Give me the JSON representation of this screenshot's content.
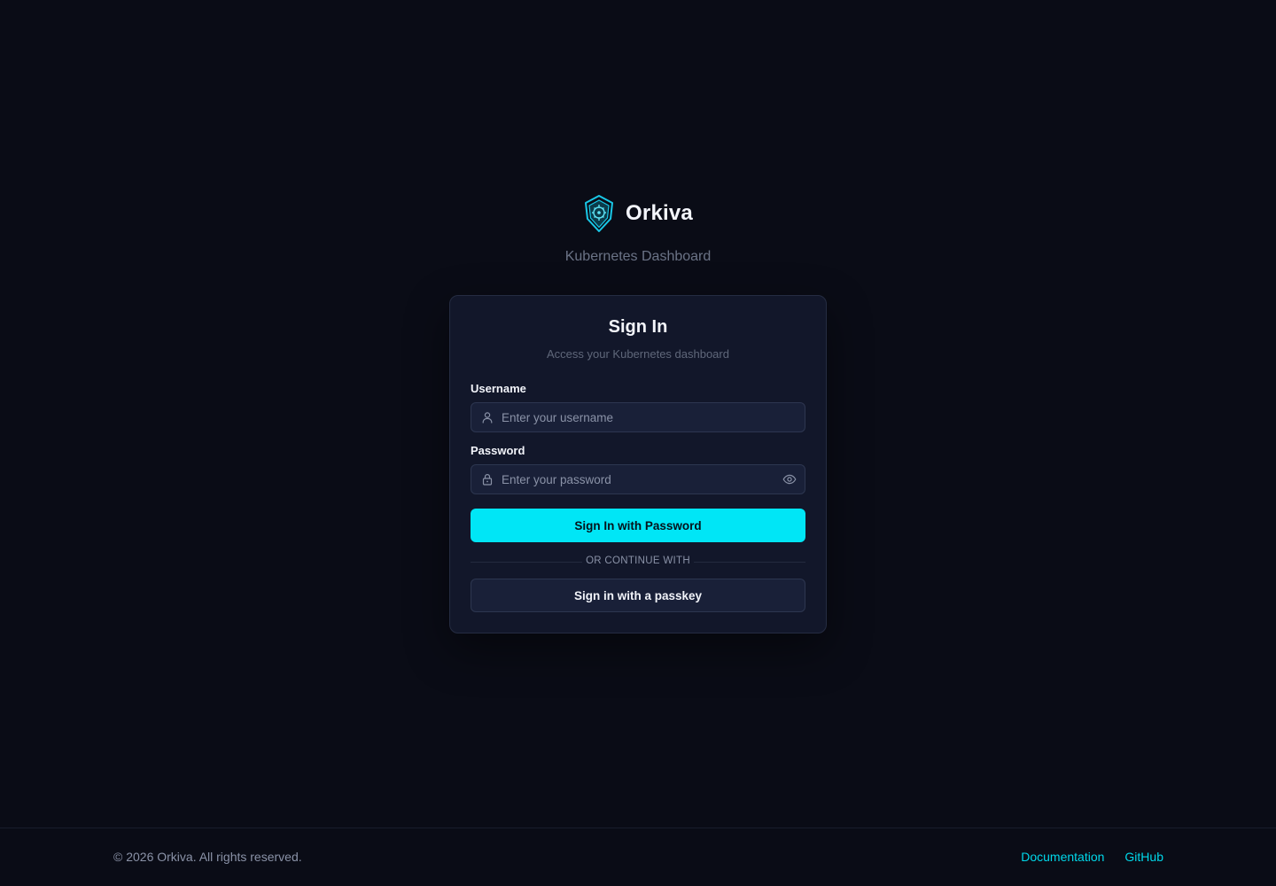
{
  "brand": {
    "name": "Orkiva",
    "tagline": "Kubernetes Dashboard",
    "logo_icon": "shield-helm-logo",
    "accent_color": "#00e6f6"
  },
  "card": {
    "title": "Sign In",
    "subtitle": "Access your Kubernetes dashboard"
  },
  "form": {
    "username": {
      "label": "Username",
      "placeholder": "Enter your username",
      "value": "",
      "icon": "user-icon"
    },
    "password": {
      "label": "Password",
      "placeholder": "Enter your password",
      "value": "",
      "icon": "lock-icon",
      "toggle_icon": "eye-icon"
    },
    "submit_label": "Sign In with Password",
    "divider_text": "OR CONTINUE WITH",
    "passkey_label": "Sign in with a passkey"
  },
  "footer": {
    "copyright": "© 2026 Orkiva. All rights reserved.",
    "links": [
      {
        "label": "Documentation"
      },
      {
        "label": "GitHub"
      }
    ]
  }
}
